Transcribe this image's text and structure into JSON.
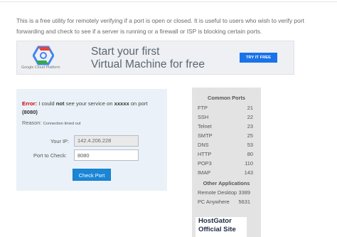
{
  "intro": {
    "text": "This is a free utility for remotely verifying if a port is open or closed. It is useful to users who wish to verify port forwarding and check to see if a server is running or a firewall or ISP is blocking certain ports."
  },
  "ad": {
    "brand": "Google Cloud Platform",
    "headline1": "Start your first",
    "headline2": "Virtual Machine for free",
    "cta": "TRY IT FREE",
    "logo_icon": "google-cloud-hexagon-icon"
  },
  "check": {
    "error_prefix": "Error:",
    "error_text1": " I could ",
    "error_not": "not",
    "error_text2": " see your service on ",
    "error_host": "xxxxx",
    "error_text3": " on port ",
    "error_port": "(8080)",
    "reason_label": "Reason:",
    "reason_text": "Connection timed out",
    "ip_label": "Your IP:",
    "ip_value": "142.4.206.228",
    "port_label": "Port to Check:",
    "port_value": "8080",
    "button_label": "Check Port"
  },
  "common_ports": {
    "title": "Common Ports",
    "items": [
      {
        "name": "FTP",
        "port": "21"
      },
      {
        "name": "SSH",
        "port": "22"
      },
      {
        "name": "Telnet",
        "port": "23"
      },
      {
        "name": "SMTP",
        "port": "25"
      },
      {
        "name": "DNS",
        "port": "53"
      },
      {
        "name": "HTTP",
        "port": "80"
      },
      {
        "name": "POP3",
        "port": "110"
      },
      {
        "name": "IMAP",
        "port": "143"
      }
    ],
    "apps_title": "Other Applications",
    "apps": [
      {
        "name": "Remote Desktop",
        "port": "3389"
      },
      {
        "name": "PC Anywhere",
        "port": "5631"
      }
    ]
  },
  "host_ad": {
    "line1": "HostGator",
    "line2": "Official Site"
  },
  "colors": {
    "error": "#cc0000",
    "button": "#1a86d6",
    "panel": "#eaf1f8",
    "ports_panel": "#e3e3e3"
  }
}
